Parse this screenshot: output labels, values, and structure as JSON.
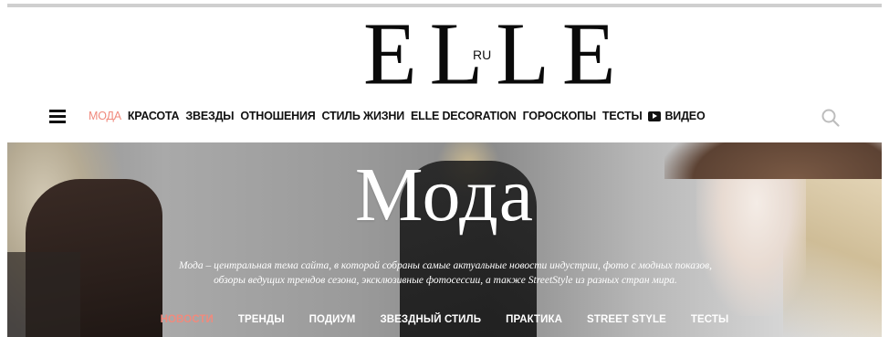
{
  "header": {
    "logo_text": "ELLE",
    "logo_suffix": "RU"
  },
  "nav": {
    "items": [
      {
        "label": "МОДА",
        "active": true
      },
      {
        "label": "КРАСОТА",
        "active": false
      },
      {
        "label": "ЗВЕЗДЫ",
        "active": false
      },
      {
        "label": "ОТНОШЕНИЯ",
        "active": false
      },
      {
        "label": "СТИЛЬ ЖИЗНИ",
        "active": false
      },
      {
        "label": "ELLE DECORATION",
        "active": false
      },
      {
        "label": "ГОРОСКОПЫ",
        "active": false
      },
      {
        "label": "ТЕСТЫ",
        "active": false
      },
      {
        "label": "ВИДЕО",
        "active": false,
        "icon": "video-icon"
      }
    ],
    "menu_icon": "hamburger-menu-icon",
    "search_icon": "search-icon"
  },
  "hero": {
    "title": "Мода",
    "description_line1": "Мода – центральная тема сайта, в которой собраны самые актуальные новости индустрии, фото с модных показов,",
    "description_line2": "обзоры ведущих трендов сезона, эксклюзивные фотосессии, а также StreetStyle из разных стран мира.",
    "tabs": [
      {
        "label": "НОВОСТИ",
        "active": true
      },
      {
        "label": "ТРЕНДЫ",
        "active": false
      },
      {
        "label": "ПОДИУМ",
        "active": false
      },
      {
        "label": "ЗВЕЗДНЫЙ СТИЛЬ",
        "active": false
      },
      {
        "label": "ПРАКТИКА",
        "active": false
      },
      {
        "label": "STREET STYLE",
        "active": false
      },
      {
        "label": "ТЕСТЫ",
        "active": false
      }
    ]
  },
  "colors": {
    "accent": "#f08a7d",
    "text": "#111111",
    "hero_text": "#ffffff"
  }
}
